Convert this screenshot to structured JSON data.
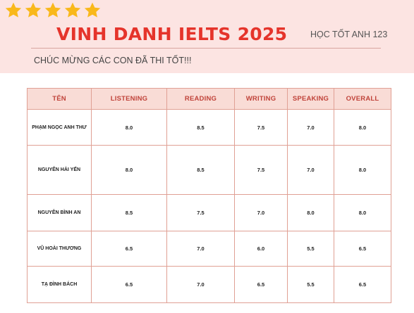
{
  "colors": {
    "banner_bg": "#fce4e2",
    "title": "#e5342b",
    "header_bg": "#f9dcd6",
    "header_text": "#c0433a",
    "border": "#e0a094",
    "star": "#f9b81b"
  },
  "header": {
    "title": "VINH DANH IELTS 2025",
    "brand": "HỌC TỐT ANH 123",
    "subtitle": "CHÚC MỪNG CÁC CON ĐÃ THI TỐT!!!",
    "stars": {
      "icon": "star-icon",
      "count": 5
    }
  },
  "table": {
    "columns": [
      "TÊN",
      "LISTENING",
      "READING",
      "WRITING",
      "SPEAKING",
      "OVERALL"
    ],
    "rows": [
      {
        "name": "PHẠM NGỌC ANH THƯ",
        "listening": "8.0",
        "reading": "8.5",
        "writing": "7.5",
        "speaking": "7.0",
        "overall": "8.0"
      },
      {
        "name": "NGUYỄN HẢI YẾN",
        "listening": "8.0",
        "reading": "8.5",
        "writing": "7.5",
        "speaking": "7.0",
        "overall": "8.0"
      },
      {
        "name": "NGUYỄN BÌNH AN",
        "listening": "8.5",
        "reading": "7.5",
        "writing": "7.0",
        "speaking": "8.0",
        "overall": "8.0"
      },
      {
        "name": "VŨ HOÀI THƯƠNG",
        "listening": "6.5",
        "reading": "7.0",
        "writing": "6.0",
        "speaking": "5.5",
        "overall": "6.5"
      },
      {
        "name": "TẠ ĐÌNH BÁCH",
        "listening": "6.5",
        "reading": "7.0",
        "writing": "6.5",
        "speaking": "5.5",
        "overall": "6.5"
      }
    ]
  }
}
